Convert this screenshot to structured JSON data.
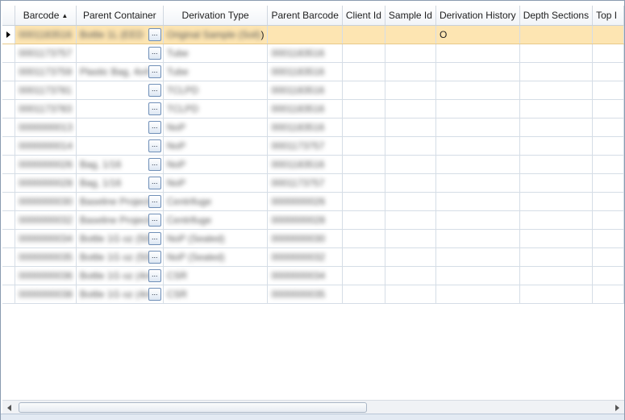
{
  "columns": [
    {
      "key": "barcode",
      "label": "Barcode",
      "sort": "ascending"
    },
    {
      "key": "parent_container",
      "label": "Parent Container"
    },
    {
      "key": "derivation_type",
      "label": "Derivation Type"
    },
    {
      "key": "parent_barcode",
      "label": "Parent Barcode"
    },
    {
      "key": "client_id",
      "label": "Client Id"
    },
    {
      "key": "sample_id",
      "label": "Sample Id"
    },
    {
      "key": "derivation_history",
      "label": "Derivation History"
    },
    {
      "key": "depth_sections",
      "label": "Depth Sections"
    },
    {
      "key": "top",
      "label": "Top I"
    }
  ],
  "selected_row_index": 0,
  "ellipsis_label": "...",
  "sort_indicator": "▲",
  "rows": [
    {
      "barcode": "0001183516",
      "parent_container": "Bottle 1L (EED",
      "derivation_type": "Original Sample (Soil)",
      "derivation_type_suffix": ")",
      "parent_barcode": "",
      "client_id": "",
      "sample_id": "",
      "derivation_history": "O",
      "depth_sections": "",
      "top": ""
    },
    {
      "barcode": "0001173757",
      "parent_container": "",
      "derivation_type": "Tube",
      "parent_barcode": "0001183516",
      "client_id": "",
      "sample_id": "",
      "derivation_history": "",
      "depth_sections": "",
      "top": ""
    },
    {
      "barcode": "0001173759",
      "parent_container": "Plastic Bag, 4x4 Tis",
      "derivation_type": "Tube",
      "parent_barcode": "0001183516",
      "client_id": "",
      "sample_id": "",
      "derivation_history": "",
      "depth_sections": "",
      "top": ""
    },
    {
      "barcode": "0001173781",
      "parent_container": "",
      "derivation_type": "TCLPD",
      "parent_barcode": "0001183516",
      "client_id": "",
      "sample_id": "",
      "derivation_history": "",
      "depth_sections": "",
      "top": ""
    },
    {
      "barcode": "0001173783",
      "parent_container": "",
      "derivation_type": "TCLPD",
      "parent_barcode": "0001183516",
      "client_id": "",
      "sample_id": "",
      "derivation_history": "",
      "depth_sections": "",
      "top": ""
    },
    {
      "barcode": "0000000013",
      "parent_container": "",
      "derivation_type": "NoP",
      "parent_barcode": "0001183516",
      "client_id": "",
      "sample_id": "",
      "derivation_history": "",
      "depth_sections": "",
      "top": ""
    },
    {
      "barcode": "0000000014",
      "parent_container": "",
      "derivation_type": "NoP",
      "parent_barcode": "0001173757",
      "client_id": "",
      "sample_id": "",
      "derivation_history": "",
      "depth_sections": "",
      "top": ""
    },
    {
      "barcode": "0000000026",
      "parent_container": "Bag, 1/16",
      "derivation_type": "NoP",
      "parent_barcode": "0001183516",
      "client_id": "",
      "sample_id": "",
      "derivation_history": "",
      "depth_sections": "",
      "top": ""
    },
    {
      "barcode": "0000000028",
      "parent_container": "Bag, 1/16",
      "derivation_type": "NoP",
      "parent_barcode": "0001173757",
      "client_id": "",
      "sample_id": "",
      "derivation_history": "",
      "depth_sections": "",
      "top": ""
    },
    {
      "barcode": "0000000030",
      "parent_container": "Baseline Projects",
      "derivation_type": "Centrifuge",
      "parent_barcode": "0000000026",
      "client_id": "",
      "sample_id": "",
      "derivation_history": "",
      "depth_sections": "",
      "top": ""
    },
    {
      "barcode": "0000000032",
      "parent_container": "Baseline Projects",
      "derivation_type": "Centrifuge",
      "parent_barcode": "0000000028",
      "client_id": "",
      "sample_id": "",
      "derivation_history": "",
      "depth_sections": "",
      "top": ""
    },
    {
      "barcode": "0000000034",
      "parent_container": "Bottle 1G oz (500",
      "derivation_type": "NoP (Sealed)",
      "parent_barcode": "0000000030",
      "client_id": "",
      "sample_id": "",
      "derivation_history": "",
      "depth_sections": "",
      "top": ""
    },
    {
      "barcode": "0000000035",
      "parent_container": "Bottle 1G oz (500",
      "derivation_type": "NoP (Sealed)",
      "parent_barcode": "0000000032",
      "client_id": "",
      "sample_id": "",
      "derivation_history": "",
      "depth_sections": "",
      "top": ""
    },
    {
      "barcode": "0000000036",
      "parent_container": "Bottle 1G oz (4m",
      "derivation_type": "CSR",
      "parent_barcode": "0000000034",
      "client_id": "",
      "sample_id": "",
      "derivation_history": "",
      "depth_sections": "",
      "top": ""
    },
    {
      "barcode": "0000000038",
      "parent_container": "Bottle 1G oz (4m",
      "derivation_type": "CSR",
      "parent_barcode": "0000000035",
      "client_id": "",
      "sample_id": "",
      "derivation_history": "",
      "depth_sections": "",
      "top": ""
    }
  ]
}
